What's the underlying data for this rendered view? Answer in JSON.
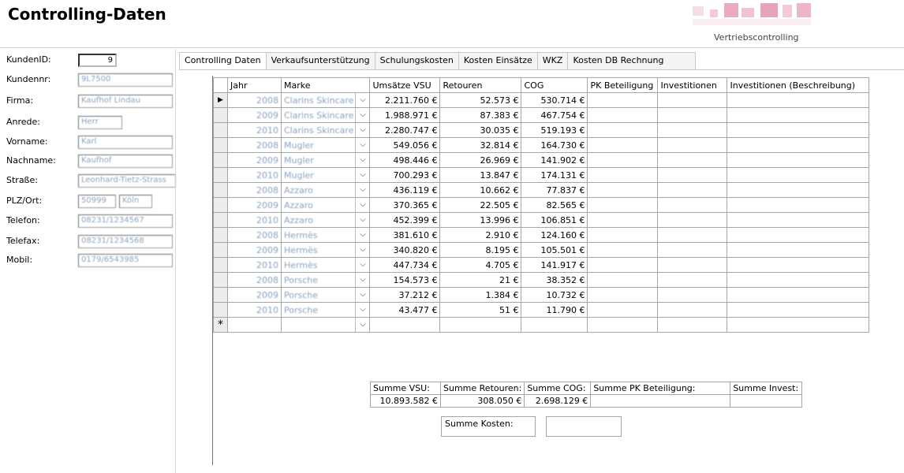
{
  "header": {
    "title": "Controlling-Daten",
    "subtitle": "Vertriebscontrolling"
  },
  "customer": {
    "fields": [
      {
        "label": "KundenID:",
        "value": "9"
      },
      {
        "label": "Kundennr:",
        "value": "9L7500"
      },
      {
        "label": "Firma:",
        "value": "Kaufhof Lindau"
      },
      {
        "label": "Anrede:",
        "value": "Herr"
      },
      {
        "label": "Vorname:",
        "value": "Karl"
      },
      {
        "label": "Nachname:",
        "value": "Kaufhof"
      },
      {
        "label": "Straße:",
        "value": "Leonhard-Tietz-Strass"
      },
      {
        "label": "PLZ/Ort:",
        "value": "50999",
        "value2": "Köln"
      },
      {
        "label": "Telefon:",
        "value": "08231/1234567"
      },
      {
        "label": "Telefax:",
        "value": "08231/1234568"
      },
      {
        "label": "Mobil:",
        "value": "0179/6543985"
      }
    ]
  },
  "tabs": [
    "Controlling Daten",
    "Verkaufsunterstützung",
    "Schulungskosten",
    "Kosten Einsätze",
    "WKZ",
    "Kosten DB Rechnung"
  ],
  "grid": {
    "columns": [
      "Jahr",
      "Marke",
      "Umsätze VSU",
      "Retouren",
      "COG",
      "PK Beteiligung",
      "Investitionen",
      "Investitionen (Beschreibung)"
    ],
    "rows": [
      {
        "jahr": "2008",
        "marke": "Clarins Skincare",
        "umsatz": "2.211.760 €",
        "retouren": "52.573 €",
        "cog": "530.714 €"
      },
      {
        "jahr": "2009",
        "marke": "Clarins Skincare",
        "umsatz": "1.988.971 €",
        "retouren": "87.383 €",
        "cog": "467.754 €"
      },
      {
        "jahr": "2010",
        "marke": "Clarins Skincare",
        "umsatz": "2.280.747 €",
        "retouren": "30.035 €",
        "cog": "519.193 €"
      },
      {
        "jahr": "2008",
        "marke": "Mugler",
        "umsatz": "549.056 €",
        "retouren": "32.814 €",
        "cog": "164.730 €"
      },
      {
        "jahr": "2009",
        "marke": "Mugler",
        "umsatz": "498.446 €",
        "retouren": "26.969 €",
        "cog": "141.902 €"
      },
      {
        "jahr": "2010",
        "marke": "Mugler",
        "umsatz": "700.293 €",
        "retouren": "13.847 €",
        "cog": "174.131 €"
      },
      {
        "jahr": "2008",
        "marke": "Azzaro",
        "umsatz": "436.119 €",
        "retouren": "10.662 €",
        "cog": "77.837 €"
      },
      {
        "jahr": "2009",
        "marke": "Azzaro",
        "umsatz": "370.365 €",
        "retouren": "22.505 €",
        "cog": "82.565 €"
      },
      {
        "jahr": "2010",
        "marke": "Azzaro",
        "umsatz": "452.399 €",
        "retouren": "13.996 €",
        "cog": "106.851 €"
      },
      {
        "jahr": "2008",
        "marke": "Hermès",
        "umsatz": "381.610 €",
        "retouren": "2.910 €",
        "cog": "124.160 €"
      },
      {
        "jahr": "2009",
        "marke": "Hermès",
        "umsatz": "340.820 €",
        "retouren": "8.195 €",
        "cog": "105.501 €"
      },
      {
        "jahr": "2010",
        "marke": "Hermès",
        "umsatz": "447.734 €",
        "retouren": "4.705 €",
        "cog": "141.917 €"
      },
      {
        "jahr": "2008",
        "marke": "Porsche",
        "umsatz": "154.573 €",
        "retouren": "21 €",
        "cog": "38.352 €"
      },
      {
        "jahr": "2009",
        "marke": "Porsche",
        "umsatz": "37.212 €",
        "retouren": "1.384 €",
        "cog": "10.732 €"
      },
      {
        "jahr": "2010",
        "marke": "Porsche",
        "umsatz": "43.477 €",
        "retouren": "51 €",
        "cog": "11.790 €"
      }
    ],
    "new_row_marker": "*",
    "current_row_marker": "▶"
  },
  "summary": {
    "labels": [
      "Summe VSU:",
      "Summe Retouren:",
      "Summe COG:",
      "Summe PK Beteiligung:",
      "Summe Invest:"
    ],
    "values": [
      "10.893.582 €",
      "308.050 €",
      "2.698.129 €",
      "",
      ""
    ],
    "kosten_label": "Summe Kosten:",
    "kosten_value": ""
  }
}
